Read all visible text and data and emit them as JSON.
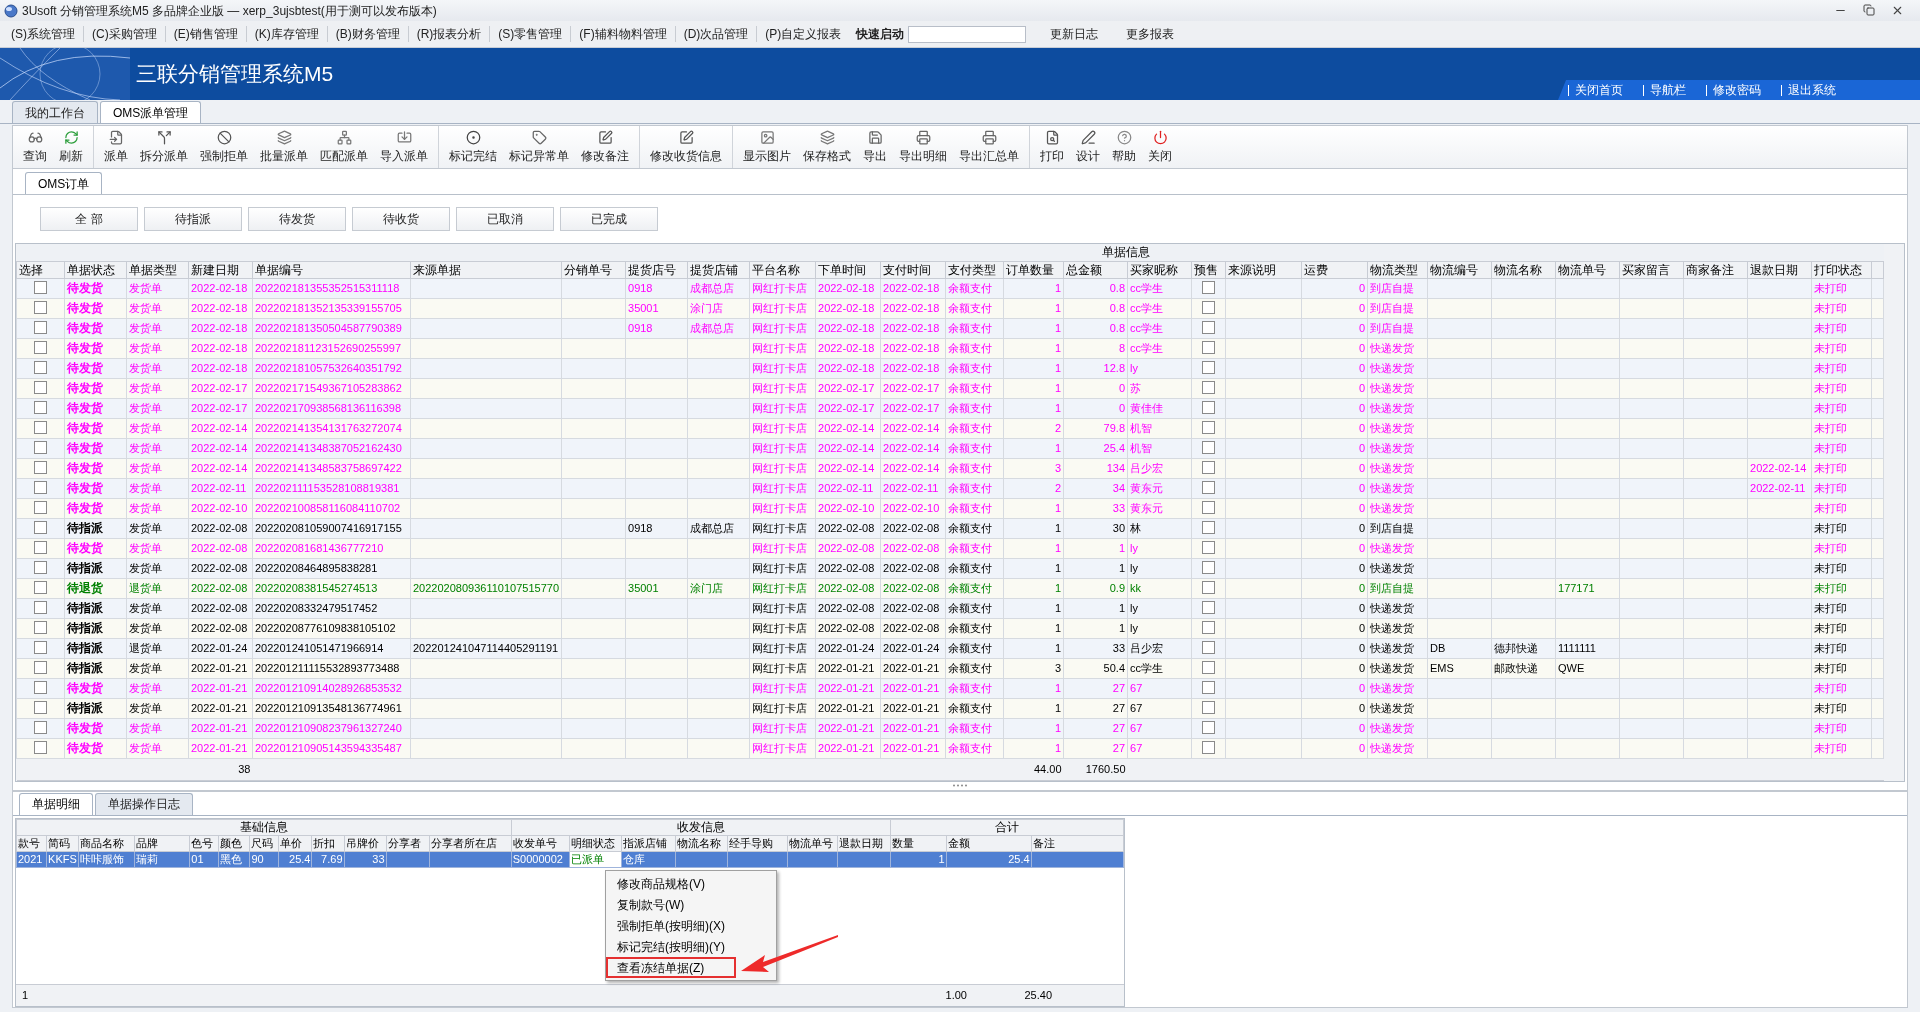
{
  "window": {
    "title": "3Usoft 分销管理系统M5 多品牌企业版 — xerp_3ujsbtest(用于测可以发布版本)"
  },
  "menu_bar": [
    "(S)系统管理",
    "(C)采购管理",
    "(E)销售管理",
    "(K)库存管理",
    "(B)财务管理",
    "(R)报表分析",
    "(S)零售管理",
    "(F)辅料物料管理",
    "(D)次品管理",
    "(P)自定义报表"
  ],
  "quick_launch": {
    "label": "快速启动"
  },
  "menu_links": [
    "更新日志",
    "更多报表"
  ],
  "banner": {
    "title": "三联分销管理系统M5",
    "links": [
      "关闭首页",
      "导航栏",
      "修改密码",
      "退出系统"
    ]
  },
  "tabs": [
    {
      "label": "我的工作台",
      "selected": false
    },
    {
      "label": "OMS派单管理",
      "selected": true
    }
  ],
  "toolbar": [
    [
      "查询",
      "刷新"
    ],
    [
      "派单",
      "拆分派单",
      "强制拒单",
      "批量派单",
      "匹配派单",
      "导入派单"
    ],
    [
      "标记完结",
      "标记异常单",
      "修改备注"
    ],
    [
      "修改收货信息"
    ],
    [
      "显示图片",
      "保存格式",
      "导出",
      "导出明细",
      "导出汇总单"
    ],
    [
      "打印",
      "设计",
      "帮助",
      "关闭"
    ]
  ],
  "sub_tabs": [
    {
      "label": "OMS订单",
      "selected": true
    }
  ],
  "filters": [
    "全 部",
    "待指派",
    "待发货",
    "待收货",
    "已取消",
    "已完成"
  ],
  "orders": {
    "group_header": "单据信息",
    "columns": [
      {
        "label": "选择",
        "kind": "checkbox"
      },
      {
        "label": "单据状态",
        "kind": "text"
      },
      {
        "label": "单据类型",
        "kind": "text"
      },
      {
        "label": "新建日期",
        "kind": "text"
      },
      {
        "label": "单据编号",
        "kind": "text"
      },
      {
        "label": "来源单据",
        "kind": "text"
      },
      {
        "label": "分销单号",
        "kind": "text"
      },
      {
        "label": "提货店号",
        "kind": "text"
      },
      {
        "label": "提货店铺",
        "kind": "text"
      },
      {
        "label": "平台名称",
        "kind": "text"
      },
      {
        "label": "下单时间",
        "kind": "text"
      },
      {
        "label": "支付时间",
        "kind": "text"
      },
      {
        "label": "支付类型",
        "kind": "text"
      },
      {
        "label": "订单数量",
        "kind": "number"
      },
      {
        "label": "总金额",
        "kind": "number"
      },
      {
        "label": "买家昵称",
        "kind": "text"
      },
      {
        "label": "预售",
        "kind": "checkbox"
      },
      {
        "label": "来源说明",
        "kind": "text"
      },
      {
        "label": "运费",
        "kind": "number"
      },
      {
        "label": "物流类型",
        "kind": "text"
      },
      {
        "label": "物流编号",
        "kind": "text"
      },
      {
        "label": "物流名称",
        "kind": "text"
      },
      {
        "label": "物流单号",
        "kind": "text"
      },
      {
        "label": "买家留言",
        "kind": "text"
      },
      {
        "label": "商家备注",
        "kind": "text"
      },
      {
        "label": "退款日期",
        "kind": "text"
      },
      {
        "label": "打印状态",
        "kind": "text"
      }
    ],
    "rows": [
      {
        "color": "#ff00ff",
        "checked": false,
        "presale": false,
        "status": "待发货",
        "type": "发货单",
        "created": "2022-02-18",
        "number": "202202181355352515311118",
        "store_no": "0918",
        "store": "成都总店",
        "platform": "网红打卡店",
        "order_time": "2022-02-18",
        "pay_time": "2022-02-18",
        "pay_type": "余额支付",
        "qty": "1",
        "amount": "0.8",
        "buyer": "cc学生",
        "freight": "0",
        "logistics_type": "到店自提",
        "print_status": "未打印"
      },
      {
        "color": "#ff00ff",
        "checked": false,
        "presale": false,
        "status": "待发货",
        "type": "发货单",
        "created": "2022-02-18",
        "number": "202202181352135339155705",
        "store_no": "35001",
        "store": "涂门店",
        "platform": "网红打卡店",
        "order_time": "2022-02-18",
        "pay_time": "2022-02-18",
        "pay_type": "余额支付",
        "qty": "1",
        "amount": "0.8",
        "buyer": "cc学生",
        "freight": "0",
        "logistics_type": "到店自提",
        "print_status": "未打印"
      },
      {
        "color": "#ff00ff",
        "checked": false,
        "presale": false,
        "status": "待发货",
        "type": "发货单",
        "created": "2022-02-18",
        "number": "202202181350504587790389",
        "store_no": "0918",
        "store": "成都总店",
        "platform": "网红打卡店",
        "order_time": "2022-02-18",
        "pay_time": "2022-02-18",
        "pay_type": "余额支付",
        "qty": "1",
        "amount": "0.8",
        "buyer": "cc学生",
        "freight": "0",
        "logistics_type": "到店自提",
        "print_status": "未打印"
      },
      {
        "color": "#ff00ff",
        "checked": false,
        "presale": false,
        "status": "待发货",
        "type": "发货单",
        "created": "2022-02-18",
        "number": "202202181123152690255997",
        "platform": "网红打卡店",
        "order_time": "2022-02-18",
        "pay_time": "2022-02-18",
        "pay_type": "余额支付",
        "qty": "1",
        "amount": "8",
        "buyer": "cc学生",
        "freight": "0",
        "logistics_type": "快递发货",
        "print_status": "未打印"
      },
      {
        "color": "#ff00ff",
        "checked": false,
        "presale": false,
        "status": "待发货",
        "type": "发货单",
        "created": "2022-02-18",
        "number": "202202181057532640351792",
        "platform": "网红打卡店",
        "order_time": "2022-02-18",
        "pay_time": "2022-02-18",
        "pay_type": "余额支付",
        "qty": "1",
        "amount": "12.8",
        "buyer": "ly",
        "freight": "0",
        "logistics_type": "快递发货",
        "print_status": "未打印"
      },
      {
        "color": "#ff00ff",
        "checked": false,
        "presale": false,
        "status": "待发货",
        "type": "发货单",
        "created": "2022-02-17",
        "number": "202202171549367105283862",
        "platform": "网红打卡店",
        "order_time": "2022-02-17",
        "pay_time": "2022-02-17",
        "pay_type": "余额支付",
        "qty": "1",
        "amount": "0",
        "buyer": "苏",
        "freight": "0",
        "logistics_type": "快递发货",
        "print_status": "未打印"
      },
      {
        "color": "#ff00ff",
        "checked": false,
        "presale": false,
        "status": "待发货",
        "type": "发货单",
        "created": "2022-02-17",
        "number": "202202170938568136116398",
        "platform": "网红打卡店",
        "order_time": "2022-02-17",
        "pay_time": "2022-02-17",
        "pay_type": "余额支付",
        "qty": "1",
        "amount": "0",
        "buyer": "黄佳佳",
        "freight": "0",
        "logistics_type": "快递发货",
        "print_status": "未打印"
      },
      {
        "color": "#ff00ff",
        "checked": false,
        "presale": false,
        "status": "待发货",
        "type": "发货单",
        "created": "2022-02-14",
        "number": "202202141354131763272074",
        "platform": "网红打卡店",
        "order_time": "2022-02-14",
        "pay_time": "2022-02-14",
        "pay_type": "余额支付",
        "qty": "2",
        "amount": "79.8",
        "buyer": "机智",
        "freight": "0",
        "logistics_type": "快递发货",
        "print_status": "未打印"
      },
      {
        "color": "#ff00ff",
        "checked": false,
        "presale": false,
        "status": "待发货",
        "type": "发货单",
        "created": "2022-02-14",
        "number": "202202141348387052162430",
        "platform": "网红打卡店",
        "order_time": "2022-02-14",
        "pay_time": "2022-02-14",
        "pay_type": "余额支付",
        "qty": "1",
        "amount": "25.4",
        "buyer": "机智",
        "freight": "0",
        "logistics_type": "快递发货",
        "print_status": "未打印"
      },
      {
        "color": "#ff00ff",
        "checked": false,
        "presale": false,
        "status": "待发货",
        "type": "发货单",
        "created": "2022-02-14",
        "number": "202202141348583758697422",
        "platform": "网红打卡店",
        "order_time": "2022-02-14",
        "pay_time": "2022-02-14",
        "pay_type": "余额支付",
        "qty": "3",
        "amount": "134",
        "buyer": "吕少宏",
        "freight": "0",
        "logistics_type": "快递发货",
        "refund_date": "2022-02-14",
        "print_status": "未打印"
      },
      {
        "color": "#ff00ff",
        "checked": false,
        "presale": false,
        "status": "待发货",
        "type": "发货单",
        "created": "2022-02-11",
        "number": "202202111153528108819381",
        "platform": "网红打卡店",
        "order_time": "2022-02-11",
        "pay_time": "2022-02-11",
        "pay_type": "余额支付",
        "qty": "2",
        "amount": "34",
        "buyer": "黄东元",
        "freight": "0",
        "logistics_type": "快递发货",
        "refund_date": "2022-02-11",
        "print_status": "未打印"
      },
      {
        "color": "#ff00ff",
        "checked": false,
        "presale": false,
        "status": "待发货",
        "type": "发货单",
        "created": "2022-02-10",
        "number": "202202100858116084110702",
        "platform": "网红打卡店",
        "order_time": "2022-02-10",
        "pay_time": "2022-02-10",
        "pay_type": "余额支付",
        "qty": "1",
        "amount": "33",
        "buyer": "黄东元",
        "freight": "0",
        "logistics_type": "快递发货",
        "print_status": "未打印"
      },
      {
        "color": "#000000",
        "checked": false,
        "presale": false,
        "status": "待指派",
        "type": "发货单",
        "created": "2022-02-08",
        "number": "202202081059007416917155",
        "store_no": "0918",
        "store": "成都总店",
        "platform": "网红打卡店",
        "order_time": "2022-02-08",
        "pay_time": "2022-02-08",
        "pay_type": "余额支付",
        "qty": "1",
        "amount": "30",
        "buyer": "林",
        "freight": "0",
        "logistics_type": "到店自提",
        "print_status": "未打印"
      },
      {
        "color": "#ff00ff",
        "checked": false,
        "presale": false,
        "status": "待发货",
        "type": "发货单",
        "created": "2022-02-08",
        "number": "202202081681436777210",
        "platform": "网红打卡店",
        "order_time": "2022-02-08",
        "pay_time": "2022-02-08",
        "pay_type": "余额支付",
        "qty": "1",
        "amount": "1",
        "buyer": "ly",
        "freight": "0",
        "logistics_type": "快递发货",
        "print_status": "未打印"
      },
      {
        "color": "#000000",
        "checked": false,
        "presale": false,
        "status": "待指派",
        "type": "发货单",
        "created": "2022-02-08",
        "number": "20220208464895838281",
        "platform": "网红打卡店",
        "order_time": "2022-02-08",
        "pay_time": "2022-02-08",
        "pay_type": "余额支付",
        "qty": "1",
        "amount": "1",
        "buyer": "ly",
        "freight": "0",
        "logistics_type": "快递发货",
        "print_status": "未打印"
      },
      {
        "color": "#008000",
        "checked": false,
        "presale": false,
        "status": "待退货",
        "type": "退货单",
        "created": "2022-02-08",
        "number": "20220208381545274513",
        "source": "202202080936110107515770",
        "store_no": "35001",
        "store": "涂门店",
        "platform": "网红打卡店",
        "order_time": "2022-02-08",
        "pay_time": "2022-02-08",
        "pay_type": "余额支付",
        "qty": "1",
        "amount": "0.9",
        "buyer": "kk",
        "freight": "0",
        "logistics_type": "到店自提",
        "log_track": "177171",
        "print_status": "未打印"
      },
      {
        "color": "#000000",
        "checked": false,
        "presale": false,
        "status": "待指派",
        "type": "发货单",
        "created": "2022-02-08",
        "number": "20220208332479517452",
        "platform": "网红打卡店",
        "order_time": "2022-02-08",
        "pay_time": "2022-02-08",
        "pay_type": "余额支付",
        "qty": "1",
        "amount": "1",
        "buyer": "ly",
        "freight": "0",
        "logistics_type": "快递发货",
        "print_status": "未打印"
      },
      {
        "color": "#000000",
        "checked": false,
        "presale": false,
        "status": "待指派",
        "type": "发货单",
        "created": "2022-02-08",
        "number": "20220208776109838105102",
        "platform": "网红打卡店",
        "order_time": "2022-02-08",
        "pay_time": "2022-02-08",
        "pay_type": "余额支付",
        "qty": "1",
        "amount": "1",
        "buyer": "ly",
        "freight": "0",
        "logistics_type": "快递发货",
        "print_status": "未打印"
      },
      {
        "color": "#000000",
        "checked": false,
        "presale": false,
        "status": "待指派",
        "type": "退货单",
        "created": "2022-01-24",
        "number": "202201241051471966914",
        "source": "202201241047114405291191",
        "platform": "网红打卡店",
        "order_time": "2022-01-24",
        "pay_time": "2022-01-24",
        "pay_type": "余额支付",
        "qty": "1",
        "amount": "33",
        "buyer": "吕少宏",
        "freight": "0",
        "logistics_type": "快递发货",
        "log_code": "DB",
        "log_name": "德邦快递",
        "log_track": "1111111",
        "print_status": "未打印"
      },
      {
        "color": "#000000",
        "checked": false,
        "presale": false,
        "status": "待指派",
        "type": "发货单",
        "created": "2022-01-21",
        "number": "202201211115532893773488",
        "platform": "网红打卡店",
        "order_time": "2022-01-21",
        "pay_time": "2022-01-21",
        "pay_type": "余额支付",
        "qty": "3",
        "amount": "50.4",
        "buyer": "cc学生",
        "freight": "0",
        "logistics_type": "快递发货",
        "log_code": "EMS",
        "log_name": "邮政快递",
        "log_track": "QWE",
        "print_status": "未打印"
      },
      {
        "color": "#ff00ff",
        "checked": false,
        "presale": false,
        "status": "待发货",
        "type": "发货单",
        "created": "2022-01-21",
        "number": "202201210914028926853532",
        "platform": "网红打卡店",
        "order_time": "2022-01-21",
        "pay_time": "2022-01-21",
        "pay_type": "余额支付",
        "qty": "1",
        "amount": "27",
        "buyer": "67",
        "freight": "0",
        "logistics_type": "快递发货",
        "print_status": "未打印"
      },
      {
        "color": "#000000",
        "checked": false,
        "presale": false,
        "status": "待指派",
        "type": "发货单",
        "created": "2022-01-21",
        "number": "202201210913548136774961",
        "platform": "网红打卡店",
        "order_time": "2022-01-21",
        "pay_time": "2022-01-21",
        "pay_type": "余额支付",
        "qty": "1",
        "amount": "27",
        "buyer": "67",
        "freight": "0",
        "logistics_type": "快递发货",
        "print_status": "未打印"
      },
      {
        "color": "#ff00ff",
        "checked": false,
        "presale": false,
        "status": "待发货",
        "type": "发货单",
        "created": "2022-01-21",
        "number": "202201210908237961327240",
        "platform": "网红打卡店",
        "order_time": "2022-01-21",
        "pay_time": "2022-01-21",
        "pay_type": "余额支付",
        "qty": "1",
        "amount": "27",
        "buyer": "67",
        "freight": "0",
        "logistics_type": "快递发货",
        "print_status": "未打印"
      },
      {
        "color": "#ff00ff",
        "checked": false,
        "presale": false,
        "status": "待发货",
        "type": "发货单",
        "created": "2022-01-21",
        "number": "202201210905143594335487",
        "platform": "网红打卡店",
        "order_time": "2022-01-21",
        "pay_time": "2022-01-21",
        "pay_type": "余额支付",
        "qty": "1",
        "amount": "27",
        "buyer": "67",
        "freight": "0",
        "logistics_type": "快递发货",
        "print_status": "未打印"
      }
    ],
    "footer": {
      "count": "38",
      "qty": "44.00",
      "amount": "1760.50"
    }
  },
  "detail": {
    "tabs": [
      {
        "label": "单据明细",
        "selected": true
      },
      {
        "label": "单据操作日志",
        "selected": false
      }
    ],
    "groups": [
      {
        "label": "基础信息",
        "columns": [
          "款号",
          "简码",
          "商品名称",
          "品牌",
          "色号",
          "颜色",
          "尺码",
          "单价",
          "折扣",
          "吊牌价",
          "分享者",
          "分享者所在店"
        ]
      },
      {
        "label": "收发信息",
        "columns": [
          "收发单号",
          "明细状态",
          "指派店铺",
          "物流名称",
          "经手导购",
          "物流单号",
          "退款日期"
        ]
      },
      {
        "label": "合计",
        "columns": [
          "数量",
          "金额",
          "备注"
        ]
      }
    ],
    "rows": [
      {
        "selected": true,
        "code": "2021",
        "short": "KKFS",
        "name": "咔咔服饰",
        "brand": "瑞莉",
        "color_no": "01",
        "color_name": "黑色",
        "size": "90",
        "price": "25.4",
        "discount": "7.69",
        "tag_price": "33",
        "ship_no": "S0000002",
        "status": "已派单",
        "store": "仓库",
        "qty": "1",
        "amount": "25.4"
      }
    ],
    "footer": {
      "count": "1",
      "qty": "1.00",
      "amount": "25.40"
    }
  },
  "context_menu": {
    "items": [
      {
        "label": "修改商品规格(V)",
        "highlighted": false
      },
      {
        "label": "复制款号(W)",
        "highlighted": false
      },
      {
        "label": "强制拒单(按明细)(X)",
        "highlighted": false
      },
      {
        "label": "标记完结(按明细)(Y)",
        "highlighted": false
      },
      {
        "label": "查看冻结单据(Z)",
        "highlighted": true
      }
    ]
  }
}
